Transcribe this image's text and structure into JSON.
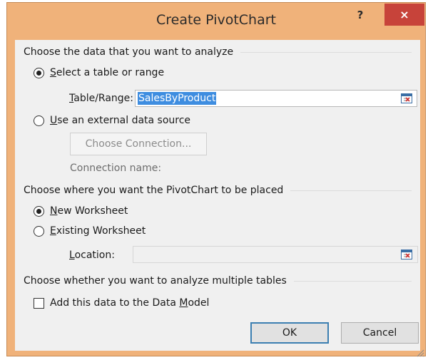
{
  "window": {
    "title": "Create PivotChart",
    "help": "?",
    "close": "×"
  },
  "data_section": {
    "heading": "Choose the data that you want to analyze",
    "option_table": {
      "pre": "",
      "key": "S",
      "post": "elect a table or range",
      "checked": true
    },
    "table_range_label": {
      "key": "T",
      "post": "able/Range:"
    },
    "table_range_value": "SalesByProduct",
    "option_external": {
      "key": "U",
      "post": "se an external data source",
      "checked": false
    },
    "choose_connection": "Choose Connection...",
    "connection_name_label": "Connection name:"
  },
  "placement_section": {
    "heading": "Choose where you want the PivotChart to be placed",
    "option_new": {
      "key": "N",
      "post": "ew Worksheet",
      "checked": true
    },
    "option_existing": {
      "key": "E",
      "post": "xisting Worksheet",
      "checked": false
    },
    "location_label": {
      "key": "L",
      "post": "ocation:"
    },
    "location_value": ""
  },
  "tables_section": {
    "heading": "Choose whether you want to analyze multiple tables",
    "add_to_model": {
      "pre": "Add this data to the Data ",
      "key": "M",
      "post": "odel",
      "checked": false
    }
  },
  "buttons": {
    "ok": "OK",
    "cancel": "Cancel"
  },
  "colors": {
    "frame": "#f0b27a",
    "close": "#c7433a",
    "selection": "#3e8de0"
  }
}
